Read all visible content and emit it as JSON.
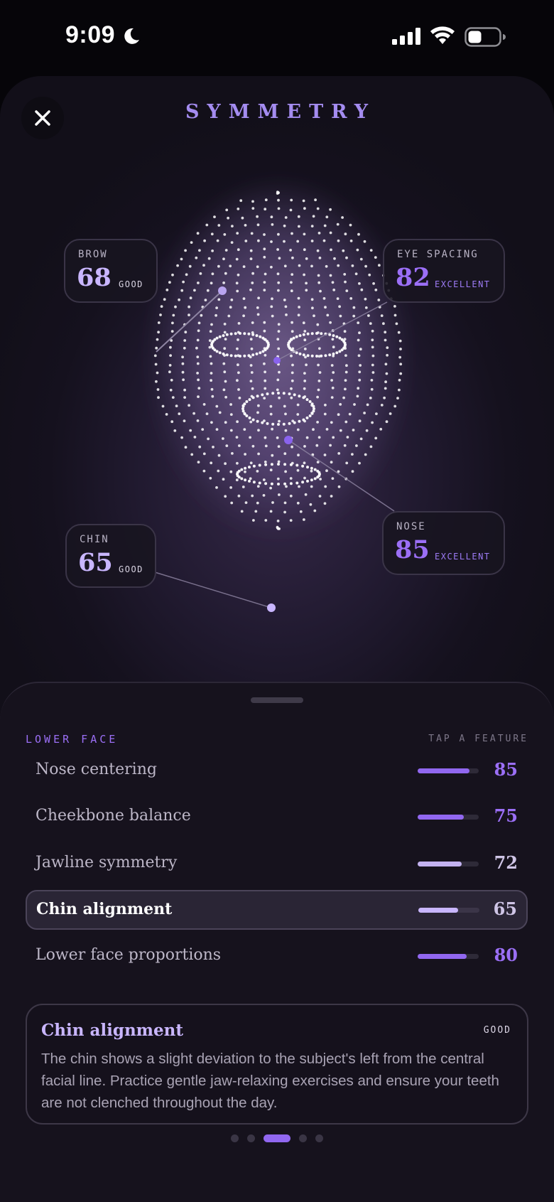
{
  "status_bar": {
    "time": "9:09",
    "icons": [
      "moon-icon",
      "signal-icon",
      "wifi-icon",
      "battery-icon"
    ]
  },
  "header": {
    "title": "SYMMETRY",
    "close_icon": "close-icon"
  },
  "colors": {
    "accent": "#9b6ff6",
    "accent_light": "#c9b6ff",
    "background": "#120f19",
    "sheet": "#16121d"
  },
  "face_metrics": {
    "brow": {
      "label": "BROW",
      "value": "68",
      "rating": "GOOD"
    },
    "eye_spacing": {
      "label": "EYE SPACING",
      "value": "82",
      "rating": "EXCELLENT"
    },
    "chin": {
      "label": "CHIN",
      "value": "65",
      "rating": "GOOD"
    },
    "nose": {
      "label": "NOSE",
      "value": "85",
      "rating": "EXCELLENT"
    }
  },
  "sheet": {
    "section_label": "LOWER FACE",
    "hint": "TAP A FEATURE",
    "features": [
      {
        "name": "Nose centering",
        "score": "85",
        "level": 0.85,
        "selected": false
      },
      {
        "name": "Cheekbone balance",
        "score": "75",
        "level": 0.75,
        "selected": false
      },
      {
        "name": "Jawline symmetry",
        "score": "72",
        "level": 0.72,
        "selected": false
      },
      {
        "name": "Chin alignment",
        "score": "65",
        "level": 0.65,
        "selected": true
      },
      {
        "name": "Lower face proportions",
        "score": "80",
        "level": 0.8,
        "selected": false
      }
    ]
  },
  "detail": {
    "title": "Chin alignment",
    "rating": "GOOD",
    "body": "The chin shows a slight deviation to the subject's left from the central facial line. Practice gentle jaw-relaxing exercises and ensure your teeth are not clenched throughout the day."
  },
  "pagination": {
    "count": 5,
    "active_index": 2
  }
}
